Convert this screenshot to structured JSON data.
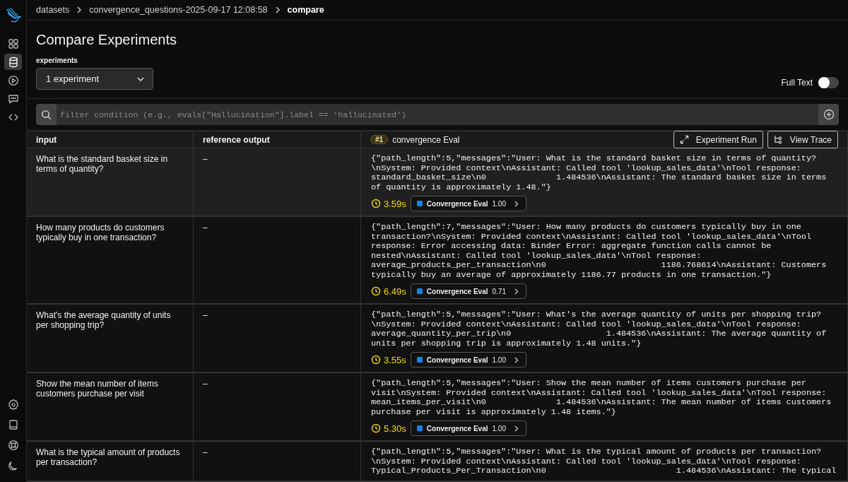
{
  "breadcrumb": [
    "datasets",
    "convergence_questions-2025-09-17 12:08:58",
    "compare"
  ],
  "sidebar": {
    "top": [
      {
        "kind": "grid",
        "selected": false
      },
      {
        "kind": "database",
        "selected": true
      },
      {
        "kind": "play",
        "selected": false
      },
      {
        "kind": "chat",
        "selected": false
      },
      {
        "kind": "code",
        "selected": false
      }
    ],
    "bottom": [
      {
        "kind": "gear"
      },
      {
        "kind": "book"
      },
      {
        "kind": "lifebuoy"
      },
      {
        "kind": "moon"
      }
    ]
  },
  "title": "Compare Experiments",
  "experiments": {
    "label": "experiments",
    "value": "1 experiment"
  },
  "full_text": {
    "label": "Full Text",
    "on": false
  },
  "filter": {
    "placeholder": "filter condition (e.g., evals[\"Hallucination\"].label == 'hallucinated')"
  },
  "table": {
    "columns": [
      "input",
      "reference output"
    ],
    "experiment_column": {
      "badge": "#1",
      "name": "convergence Eval"
    },
    "row_actions": [
      "Experiment Run",
      "View Trace"
    ],
    "rows": [
      {
        "hovered": true,
        "input": "What is the standard basket size in terms of quantity?",
        "reference": "–",
        "output": "{\"path_length\":5,\"messages\":\"User: What is the standard basket size in terms of quantity?\\nSystem: Provided context\\nAssistant: Called tool 'lookup_sales_data'\\nTool response: standard_basket_size\\n0              1.484536\\nAssistant: The standard basket size in terms of quantity is approximately 1.48.\"}",
        "latency": "3.59s",
        "eval": {
          "name": "Convergence Eval",
          "score": "1.00",
          "color": "#1a7fe6"
        }
      },
      {
        "hovered": false,
        "input": "How many products do customers typically buy in one transaction?",
        "reference": "–",
        "output": "{\"path_length\":7,\"messages\":\"User: How many products do customers typically buy in one transaction?\\nSystem: Provided context\\nAssistant: Called tool 'lookup_sales_data'\\nTool response: Error accessing data: Binder Error: aggregate function calls cannot be nested\\nAssistant: Called tool 'lookup_sales_data'\\nTool response: average_products_per_transaction\\n0                       1186.768614\\nAssistant: Customers typically buy an average of approximately 1186.77 products in one transaction.\"}",
        "latency": "6.49s",
        "eval": {
          "name": "Convergence Eval",
          "score": "0.71",
          "color": "#1a7fe6"
        }
      },
      {
        "hovered": false,
        "input": "What's the average quantity of units per shopping trip?",
        "reference": "–",
        "output": "{\"path_length\":5,\"messages\":\"User: What's the average quantity of units per shopping trip?\\nSystem: Provided context\\nAssistant: Called tool 'lookup_sales_data'\\nTool response: average_quantity_per_trip\\n0                   1.484536\\nAssistant: The average quantity of units per shopping trip is approximately 1.48 units.\"}",
        "latency": "3.55s",
        "eval": {
          "name": "Convergence Eval",
          "score": "1.00",
          "color": "#1a7fe6"
        }
      },
      {
        "hovered": false,
        "input": "Show the mean number of items customers purchase per visit",
        "reference": "–",
        "output": "{\"path_length\":5,\"messages\":\"User: Show the mean number of items customers purchase per visit\\nSystem: Provided context\\nAssistant: Called tool 'lookup_sales_data'\\nTool response: mean_items_per_visit\\n0              1.484536\\nAssistant: The mean number of items customers purchase per visit is approximately 1.48 items.\"}",
        "latency": "5.30s",
        "eval": {
          "name": "Convergence Eval",
          "score": "1.00",
          "color": "#1a7fe6"
        }
      },
      {
        "hovered": false,
        "input": "What is the typical amount of products per transaction?",
        "reference": "–",
        "output": "{\"path_length\":5,\"messages\":\"User: What is the typical amount of products per transaction?\\nSystem: Provided context\\nAssistant: Called tool 'lookup_sales_data'\\nTool response: Typical_Products_Per_Transaction\\n0                          1.484536\\nAssistant: The typical"
      }
    ]
  }
}
